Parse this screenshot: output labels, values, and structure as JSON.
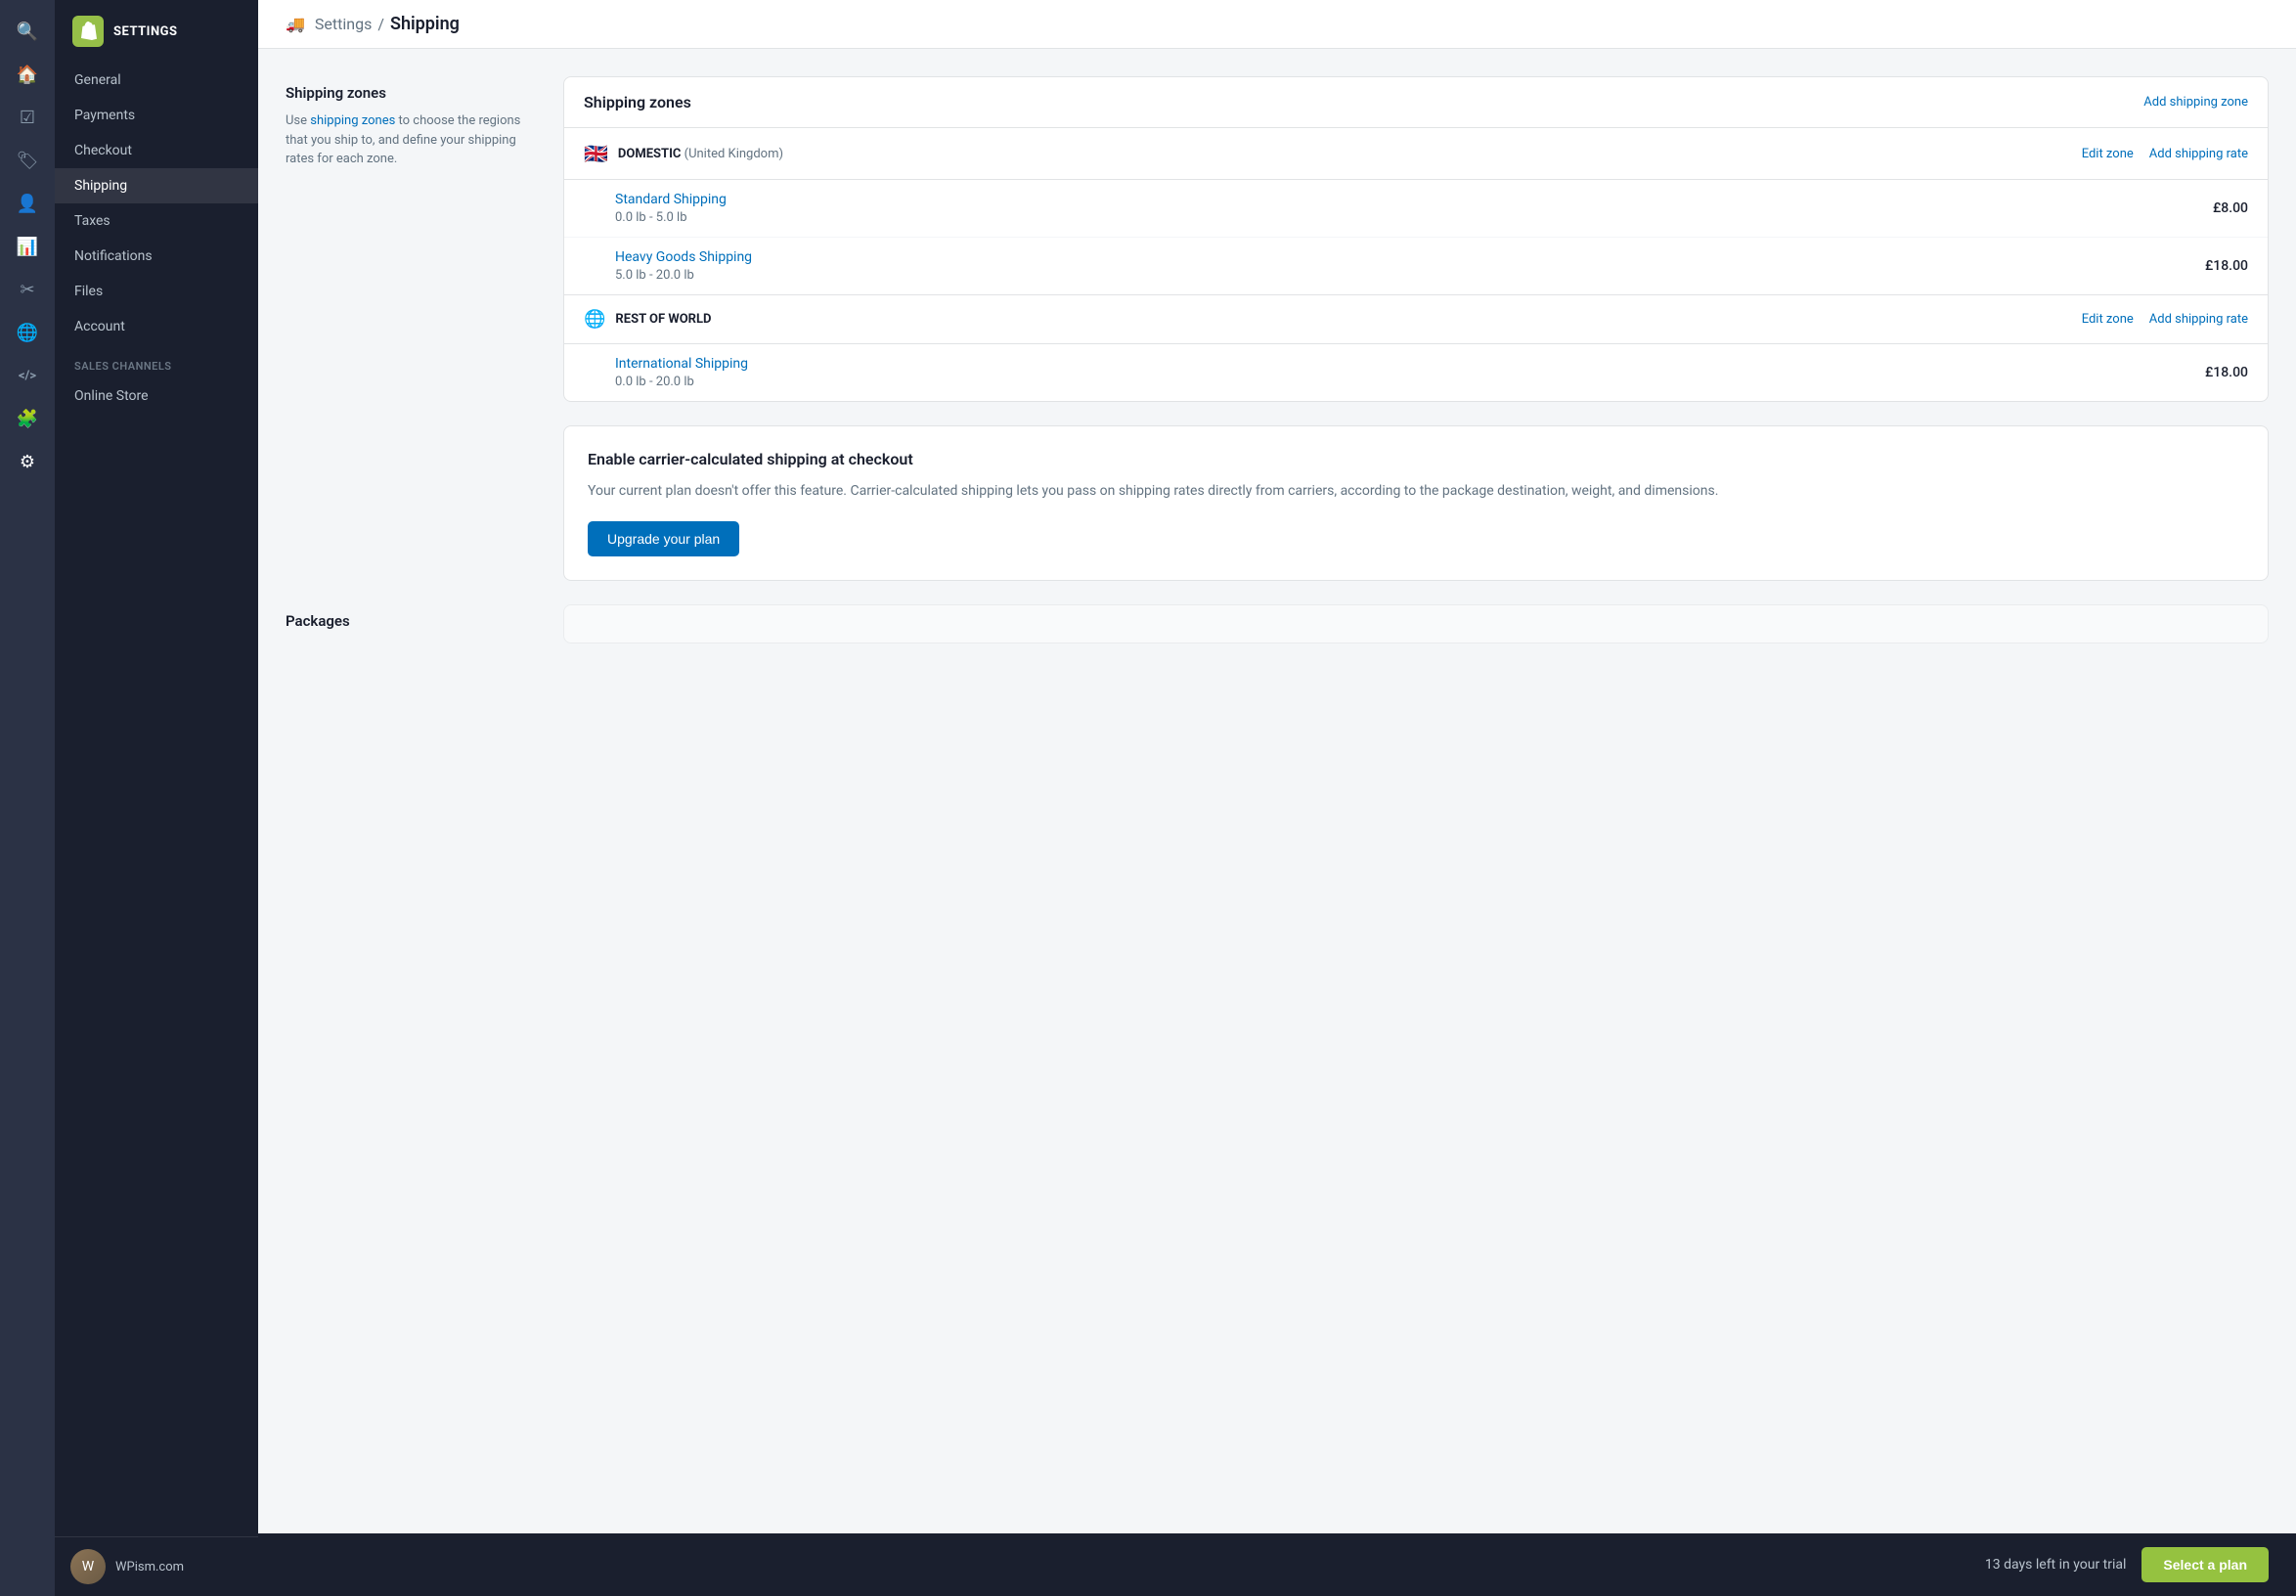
{
  "sidebar": {
    "title": "SETTINGS",
    "logo_alt": "Shopify",
    "nav_items": [
      {
        "id": "general",
        "label": "General",
        "active": false
      },
      {
        "id": "payments",
        "label": "Payments",
        "active": false
      },
      {
        "id": "checkout",
        "label": "Checkout",
        "active": false
      },
      {
        "id": "shipping",
        "label": "Shipping",
        "active": true
      },
      {
        "id": "taxes",
        "label": "Taxes",
        "active": false
      },
      {
        "id": "notifications",
        "label": "Notifications",
        "active": false
      },
      {
        "id": "files",
        "label": "Files",
        "active": false
      },
      {
        "id": "account",
        "label": "Account",
        "active": false
      }
    ],
    "nav_sections": [
      {
        "id": "sales_channels",
        "label": "Sales channels"
      },
      {
        "id": "online_store",
        "label": "Online Store"
      }
    ],
    "store_name": "WPism.com"
  },
  "icon_sidebar": {
    "icons": [
      {
        "id": "search",
        "symbol": "🔍"
      },
      {
        "id": "home",
        "symbol": "🏠"
      },
      {
        "id": "orders",
        "symbol": "✓"
      },
      {
        "id": "tags",
        "symbol": "🏷"
      },
      {
        "id": "customers",
        "symbol": "👤"
      },
      {
        "id": "analytics",
        "symbol": "📊"
      },
      {
        "id": "marketing",
        "symbol": "✂"
      },
      {
        "id": "globe",
        "symbol": "🌐"
      },
      {
        "id": "code",
        "symbol": "<>"
      },
      {
        "id": "puzzle",
        "symbol": "🧩"
      },
      {
        "id": "gear",
        "symbol": "⚙"
      }
    ]
  },
  "header": {
    "breadcrumb_icon": "🚚",
    "settings_label": "Settings",
    "separator": "/",
    "current_page": "Shipping"
  },
  "shipping_zones_section": {
    "desc_title": "Shipping zones",
    "desc_text_before": "Use ",
    "desc_link_text": "shipping zones",
    "desc_text_after": " to choose the regions that you ship to, and define your shipping rates for each zone.",
    "card_title": "Shipping zones",
    "add_zone_label": "Add shipping zone",
    "zones": [
      {
        "id": "domestic",
        "flag": "🇬🇧",
        "name": "DOMESTIC",
        "country": "(United Kingdom)",
        "edit_label": "Edit zone",
        "add_rate_label": "Add shipping rate",
        "rates": [
          {
            "id": "standard",
            "name": "Standard Shipping",
            "weight": "0.0 lb - 5.0 lb",
            "price": "£8.00"
          },
          {
            "id": "heavy",
            "name": "Heavy Goods Shipping",
            "weight": "5.0 lb - 20.0 lb",
            "price": "£18.00"
          }
        ]
      },
      {
        "id": "rest_of_world",
        "flag": "🌐",
        "name": "REST OF WORLD",
        "country": "",
        "edit_label": "Edit zone",
        "add_rate_label": "Add shipping rate",
        "rates": [
          {
            "id": "international",
            "name": "International Shipping",
            "weight": "0.0 lb - 20.0 lb",
            "price": "£18.00"
          }
        ]
      }
    ]
  },
  "carrier_section": {
    "title": "Enable carrier-calculated shipping at checkout",
    "description": "Your current plan doesn't offer this feature. Carrier-calculated shipping lets you pass on shipping rates directly from carriers, according to the package destination, weight, and dimensions.",
    "upgrade_button_label": "Upgrade your plan"
  },
  "packages_section": {
    "label": "Packages"
  },
  "trial_bar": {
    "trial_text": "13 days left in your trial",
    "select_plan_label": "Select a plan"
  }
}
